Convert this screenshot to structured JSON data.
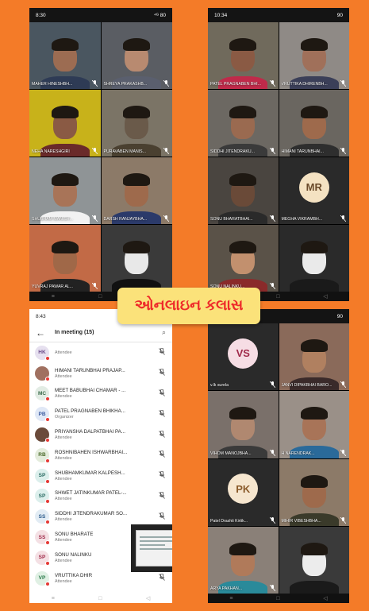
{
  "phone1": {
    "status": {
      "time": "8:30",
      "right": "⁴ᴳ 80"
    },
    "tiles": [
      {
        "name": "MAHER HINESHBH...",
        "bg": "#4a5660",
        "face": "#9c6c52",
        "shirt": "#2e3b55"
      },
      {
        "name": "SHREYA PRAKASHB...",
        "bg": "#5a5d63",
        "face": "#b88a70",
        "shirt": "#5a5f6e"
      },
      {
        "name": "NEHA NARESHGIRI",
        "bg": "#c8b21a",
        "face": "#8a5a44",
        "shirt": "#6a2a2a"
      },
      {
        "name": "PURAVABEN MANIS...",
        "bg": "#7b7466",
        "face": "#6a5a4a",
        "shirt": "#4a4030"
      },
      {
        "name": "SHUBHAM MANISH...",
        "bg": "#8f9496",
        "face": "#a87458",
        "shirt": "#f2f2f2"
      },
      {
        "name": "DARSH RANJAYBHA...",
        "bg": "#8c7a68",
        "face": "#9e6a4c",
        "shirt": "#2b3a6a"
      },
      {
        "name": "YUVRAJ PAWAR AL...",
        "bg": "#c26a46",
        "face": "#a06848",
        "shirt": "#222"
      },
      {
        "name": "",
        "bg": "#3a3a3a",
        "face": "#e8e8e8",
        "shirt": "#111"
      }
    ]
  },
  "phone2": {
    "status": {
      "time": "10:34",
      "right": "90"
    },
    "tiles": [
      {
        "name": "PATEL PRAGNABEN BHI...",
        "bg": "#706a5c",
        "face": "#8a5a44",
        "shirt": "#c02a4a"
      },
      {
        "name": "VRUTTIKA DHIRENBH...",
        "bg": "#8f8a86",
        "face": "#a0705a",
        "shirt": "#3b3f58"
      },
      {
        "name": "SIDDHI JITENDRAKU...",
        "bg": "#6c6862",
        "face": "#9a6a50",
        "shirt": "#3a3a3a"
      },
      {
        "name": "HIMANI TARUNBHAI...",
        "bg": "#6a6660",
        "face": "#9e6a4c",
        "shirt": "#2e2e2e"
      },
      {
        "name": "SONU BHARATBHAI...",
        "bg": "#4a4540",
        "face": "#6a4a38",
        "shirt": "#2a2a2a"
      },
      {
        "avatar": "MR",
        "name": "MEGHA VIKRAMBH...",
        "circle": "#f4e2c2",
        "ink": "#6a4a2a"
      },
      {
        "name": "SONU NALINKU...",
        "bg": "#5a5248",
        "face": "#c2906e",
        "shirt": "#8a2a2a"
      },
      {
        "name": "",
        "bg": "#2a2a2a",
        "face": "#eaeaea",
        "shirt": "#1a1a1a"
      }
    ]
  },
  "phone3": {
    "status": {
      "time": "8:43",
      "right": ""
    },
    "title": "In meeting (15)",
    "participants": [
      {
        "initials": "HK",
        "name": "",
        "role": "Attendee",
        "bg": "#e6e0ef",
        "ink": "#6a4a8a"
      },
      {
        "initials": "",
        "name": "HIMANI TARUNBHAI PRAJAP...",
        "role": "Attendee",
        "bg": "#a07060",
        "ink": "#fff"
      },
      {
        "initials": "MC",
        "name": "MEET BABUBHAI CHAMAR - ...",
        "role": "Attendee",
        "bg": "#e2ece4",
        "ink": "#3a6a4a"
      },
      {
        "initials": "PB",
        "name": "PATEL PRAGNABEN BHIKHA...",
        "role": "Organizer",
        "bg": "#e0e8f6",
        "ink": "#3a5aa0"
      },
      {
        "initials": "",
        "name": "PRIYANSHA DALPATBHAI PA...",
        "role": "Attendee",
        "bg": "#6a4a3a",
        "ink": "#fff"
      },
      {
        "initials": "RB",
        "name": "ROSHNIBAHEN ISHWARBHAI...",
        "role": "Attendee",
        "bg": "#e4ecdc",
        "ink": "#4a6a2a"
      },
      {
        "initials": "SP",
        "name": "SHUBHAMKUMAR KALPESH...",
        "role": "Attendee",
        "bg": "#dcefec",
        "ink": "#2a6a62"
      },
      {
        "initials": "SP",
        "name": "SHWET JATINKUMAR PATEL-...",
        "role": "Attendee",
        "bg": "#dcefec",
        "ink": "#2a6a62"
      },
      {
        "initials": "SS",
        "name": "SIDDHI JITENDRAKUMAR SO...",
        "role": "Attendee",
        "bg": "#e2ecf4",
        "ink": "#2a5a8a"
      },
      {
        "initials": "SS",
        "name": "SONU BHARATE",
        "role": "Attendee",
        "bg": "#f4e0e4",
        "ink": "#a02a4a"
      },
      {
        "initials": "SP",
        "name": "SONU NALINKU",
        "role": "Attendee",
        "bg": "#f4e0e4",
        "ink": "#a02a4a"
      },
      {
        "initials": "VP",
        "name": "VRUTTIKA DHIR",
        "role": "Attendee",
        "bg": "#e0f0e4",
        "ink": "#2a7a4a"
      }
    ]
  },
  "phone4": {
    "status": {
      "time": "",
      "right": "90"
    },
    "tiles": [
      {
        "avatar": "VS",
        "name": "v.lk surela",
        "circle": "#f6dde4",
        "ink": "#a02a4a"
      },
      {
        "name": "JANVI DIPAKBHAI BARO...",
        "bg": "#8a6a5a",
        "face": "#b08060",
        "shirt": "#3a2a2a"
      },
      {
        "name": "VIHOM MANOJBHA...",
        "bg": "#7a706a",
        "face": "#b08870",
        "shirt": "#3a3a3a"
      },
      {
        "name": "H NARENDRAK...",
        "bg": "#9a9088",
        "face": "#a87458",
        "shirt": "#2a6a9a"
      },
      {
        "avatar": "PK",
        "name": "Patel Drashti Kirtik...",
        "circle": "#f6e6cf",
        "ink": "#8a5a2a"
      },
      {
        "name": "MIHIR VIBESHBHA...",
        "bg": "#8c7a68",
        "face": "#9e6a4c",
        "shirt": "#3a3a2a"
      },
      {
        "name": "ARYA PAKHAN...",
        "bg": "#8a8078",
        "face": "#b07a5a",
        "shirt": "#2a8a9a"
      },
      {
        "name": "",
        "bg": "#3a3a3a",
        "face": "#ececec",
        "shirt": "#1a1a1a"
      }
    ]
  },
  "banner": {
    "text": "ઓનલાઇન કલાસ"
  },
  "nav": {
    "recent": "≡",
    "home": "□",
    "back": "◁"
  },
  "icons": {
    "mic_off": "🎙",
    "back_arrow": "←",
    "search": "⌕"
  }
}
